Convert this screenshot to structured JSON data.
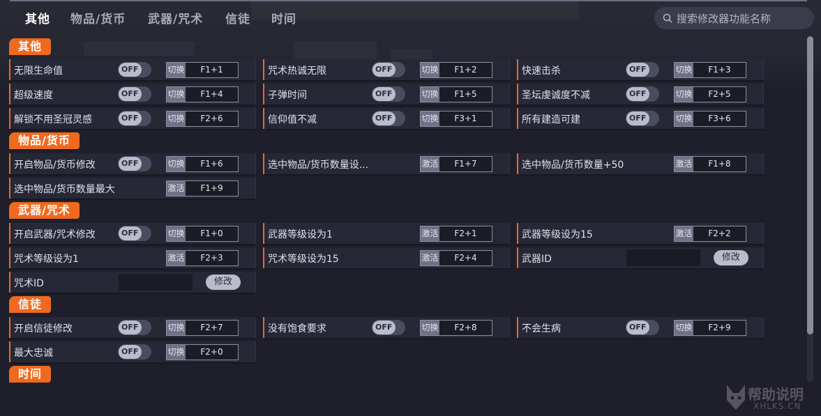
{
  "tabs": [
    "其他",
    "物品/货币",
    "武器/咒术",
    "信徒",
    "时间"
  ],
  "search": {
    "placeholder": "搜索修改器功能名称"
  },
  "labels": {
    "off": "OFF",
    "toggle": "切换",
    "activate": "激活",
    "modify": "修改"
  },
  "sections": [
    {
      "title": "其他"
    },
    {
      "title": "物品/货币"
    },
    {
      "title": "武器/咒术"
    },
    {
      "title": "信徒"
    },
    {
      "title": "时间"
    }
  ],
  "rows": [
    {
      "name": "无限生命值",
      "type": "toggle",
      "key": "F1+1"
    },
    {
      "name": "咒术热诚无限",
      "type": "toggle",
      "key": "F1+2"
    },
    {
      "name": "快速击杀",
      "type": "toggle",
      "key": "F1+3"
    },
    {
      "name": "超级速度",
      "type": "toggle",
      "key": "F1+4"
    },
    {
      "name": "子弹时间",
      "type": "toggle",
      "key": "F1+5"
    },
    {
      "name": "圣坛虔诚度不减",
      "type": "toggle",
      "key": "F2+5"
    },
    {
      "name": "解锁不用圣冠灵感",
      "type": "toggle",
      "key": "F2+6"
    },
    {
      "name": "信仰值不减",
      "type": "toggle",
      "key": "F3+1"
    },
    {
      "name": "所有建造可建",
      "type": "toggle",
      "key": "F3+6"
    },
    {
      "name": "开启物品/货币修改",
      "type": "toggle",
      "key": "F1+6"
    },
    {
      "name": "选中物品/货币数量设...",
      "type": "activate",
      "key": "F1+7"
    },
    {
      "name": "选中物品/货币数量+50",
      "type": "activate",
      "key": "F1+8"
    },
    {
      "name": "选中物品/货币数量最大",
      "type": "activate",
      "key": "F1+9"
    },
    {
      "name": "开启武器/咒术修改",
      "type": "toggle",
      "key": "F1+0"
    },
    {
      "name": "武器等级设为1",
      "type": "activate",
      "key": "F2+1"
    },
    {
      "name": "武器等级设为15",
      "type": "activate",
      "key": "F2+2"
    },
    {
      "name": "咒术等级设为1",
      "type": "activate",
      "key": "F2+3"
    },
    {
      "name": "咒术等级设为15",
      "type": "activate",
      "key": "F2+4"
    },
    {
      "name": "武器ID",
      "type": "input"
    },
    {
      "name": "咒术ID",
      "type": "input"
    },
    {
      "name": "开启信徒修改",
      "type": "toggle",
      "key": "F2+7"
    },
    {
      "name": "没有饱食要求",
      "type": "toggle",
      "key": "F2+8"
    },
    {
      "name": "不会生病",
      "type": "toggle",
      "key": "F2+9"
    },
    {
      "name": "最大忠诚",
      "type": "toggle",
      "key": "F2+0"
    }
  ],
  "watermark": {
    "line1": "帮助说明",
    "line2": "XHLKS.CN"
  }
}
